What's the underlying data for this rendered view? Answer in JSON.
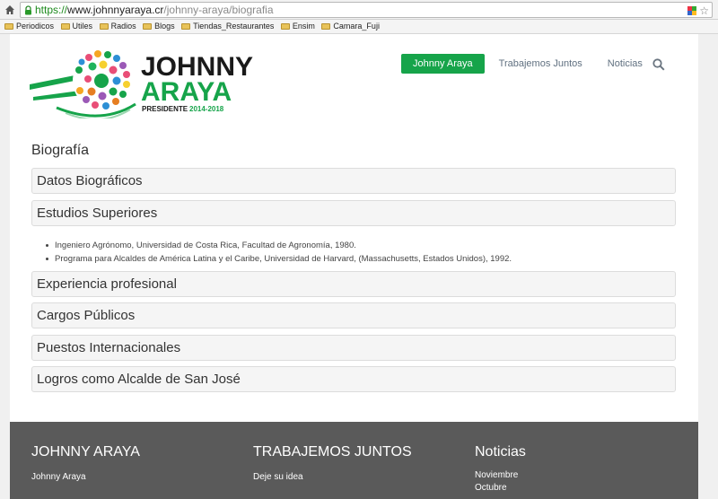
{
  "browser": {
    "url_protocol": "https://",
    "url_host": "www.johnnyaraya.cr",
    "url_path": "/johnny-araya/biografia",
    "bookmarks": [
      "Periodicos",
      "Utiles",
      "Radios",
      "Blogs",
      "Tiendas_Restaurantes",
      "Ensim",
      "Camara_Fuji"
    ]
  },
  "header": {
    "logo_line1": "JOHNNY",
    "logo_line2": "ARAYA",
    "logo_tag_a": "PRESIDENTE",
    "logo_tag_b": "2014-2018",
    "nav": [
      "Johnny Araya",
      "Trabajemos Juntos",
      "Noticias"
    ]
  },
  "main": {
    "title": "Biografía",
    "sections": [
      "Datos Biográficos",
      "Estudios Superiores",
      "Experiencia profesional",
      "Cargos Públicos",
      "Puestos Internacionales",
      "Logros como Alcalde de San José"
    ],
    "studies": [
      "Ingeniero Agrónomo, Universidad de Costa Rica, Facultad de Agronomía, 1980.",
      "Programa para Alcaldes de América Latina y el Caribe, Universidad de Harvard, (Massachusetts, Estados Unidos), 1992."
    ]
  },
  "footer": {
    "col1": {
      "title": "JOHNNY ARAYA",
      "links": [
        "Johnny Araya"
      ]
    },
    "col2": {
      "title": "TRABAJEMOS JUNTOS",
      "links": [
        "Deje su idea"
      ]
    },
    "col3": {
      "title": "Noticias",
      "links": [
        "Noviembre",
        "Octubre"
      ]
    }
  },
  "colors": {
    "brand_green": "#16a44a",
    "footer_bg": "#5a5a5a"
  }
}
